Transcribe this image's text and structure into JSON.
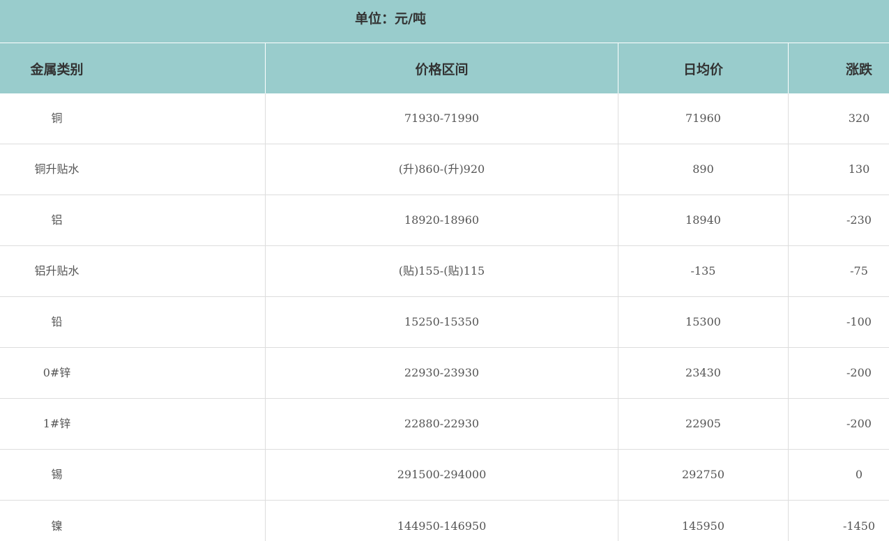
{
  "unit_caption": "单位：元/吨",
  "columns": {
    "metal": "金属类别",
    "range": "价格区间",
    "avg": "日均价",
    "change": "涨跌"
  },
  "rows": [
    {
      "metal": "铜",
      "range": "71930-71990",
      "avg": "71960",
      "change": "320"
    },
    {
      "metal": "铜升贴水",
      "range": "(升)860-(升)920",
      "avg": "890",
      "change": "130"
    },
    {
      "metal": "铝",
      "range": "18920-18960",
      "avg": "18940",
      "change": "-230"
    },
    {
      "metal": "铝升贴水",
      "range": "(贴)155-(贴)115",
      "avg": "-135",
      "change": "-75"
    },
    {
      "metal": "铅",
      "range": "15250-15350",
      "avg": "15300",
      "change": "-100"
    },
    {
      "metal": "0#锌",
      "range": "22930-23930",
      "avg": "23430",
      "change": "-200"
    },
    {
      "metal": "1#锌",
      "range": "22880-22930",
      "avg": "22905",
      "change": "-200"
    },
    {
      "metal": "锡",
      "range": "291500-294000",
      "avg": "292750",
      "change": "0"
    },
    {
      "metal": "镍",
      "range": "144950-146950",
      "avg": "145950",
      "change": "-1450"
    }
  ],
  "colors": {
    "header_bg": "#99cccc",
    "grid_line": "#dddddd",
    "body_text": "#555555",
    "header_text": "#333333"
  }
}
